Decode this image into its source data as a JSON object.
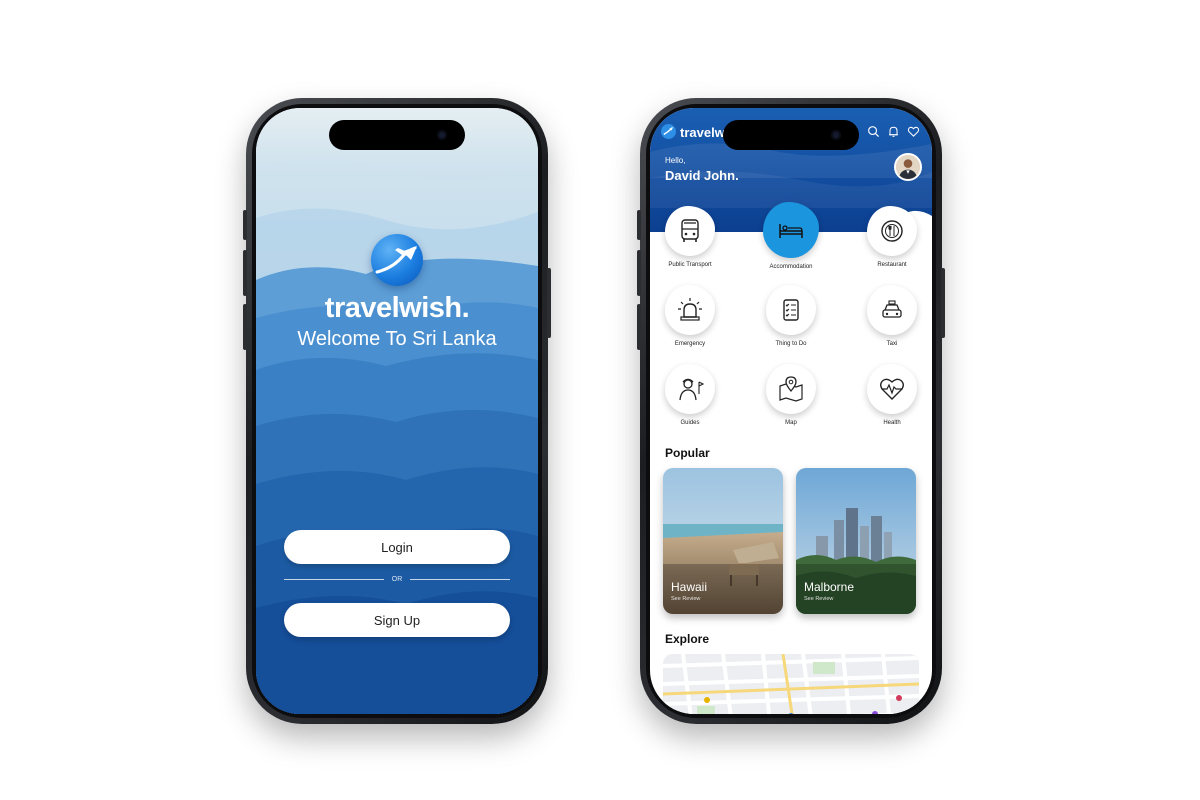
{
  "brand": {
    "name": "travelwish."
  },
  "welcome": {
    "tagline": "Welcome To Sri Lanka",
    "login_label": "Login",
    "or_label": "OR",
    "signup_label": "Sign Up"
  },
  "home": {
    "greeting": "Hello,",
    "user_name": "David John.",
    "top_icons": [
      "search-icon",
      "bell-icon",
      "heart-icon"
    ],
    "categories": [
      {
        "label": "Public Transport",
        "icon": "bus-icon",
        "active": false
      },
      {
        "label": "Accommodation",
        "icon": "bed-icon",
        "active": true
      },
      {
        "label": "Restaurant",
        "icon": "plate-cutlery-icon",
        "active": false
      },
      {
        "label": "Emergency",
        "icon": "siren-icon",
        "active": false
      },
      {
        "label": "Thing to Do",
        "icon": "checklist-icon",
        "active": false
      },
      {
        "label": "Taxi",
        "icon": "taxi-icon",
        "active": false
      },
      {
        "label": "Guides",
        "icon": "guide-icon",
        "active": false
      },
      {
        "label": "Map",
        "icon": "map-pin-icon",
        "active": false
      },
      {
        "label": "Health",
        "icon": "heart-pulse-icon",
        "active": false
      }
    ],
    "popular_title": "Popular",
    "popular": [
      {
        "name": "Hawaii",
        "sub": "See Review"
      },
      {
        "name": "Malborne",
        "sub": "See Review"
      }
    ],
    "explore_title": "Explore"
  },
  "colors": {
    "primary_blue": "#1e63b0",
    "dark_blue": "#0d3f8f",
    "accent_blue": "#1c95df"
  }
}
